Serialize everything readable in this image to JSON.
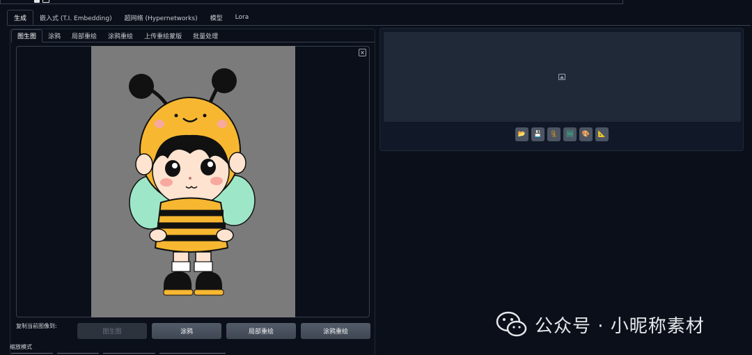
{
  "main_tabs": [
    "生成",
    "嵌入式 (T.I. Embedding)",
    "超网络 (Hypernetworks)",
    "模型",
    "Lora"
  ],
  "sub_tabs": [
    "图生图",
    "涂鸦",
    "局部重绘",
    "涂鸦重绘",
    "上传重绘蒙版",
    "批量处理"
  ],
  "image_panel": {
    "close_symbol": "×"
  },
  "copy_section": {
    "label": "复制当前图像到:",
    "buttons": [
      "图生图",
      "涂鸦",
      "局部重绘",
      "涂鸦重绘"
    ]
  },
  "resize": {
    "label": "缩放模式"
  },
  "output": {
    "placeholder_icon": "image-placeholder-icon",
    "tools": [
      {
        "name": "folder-icon",
        "glyph": "📂"
      },
      {
        "name": "save-icon",
        "glyph": "💾"
      },
      {
        "name": "zip-icon",
        "glyph": "🗜"
      },
      {
        "name": "send-to-img2img-icon",
        "glyph": "🖼"
      },
      {
        "name": "palette-icon",
        "glyph": "🎨"
      },
      {
        "name": "ruler-icon",
        "glyph": "📐"
      }
    ]
  },
  "watermark": {
    "text": "公众号 · 小昵称素材"
  },
  "colors": {
    "background": "#0b0f19",
    "panel": "#111827",
    "border": "#374151",
    "button": "#4b5563",
    "canvas": "#7b7b7b",
    "bee_yellow": "#f7b731"
  }
}
